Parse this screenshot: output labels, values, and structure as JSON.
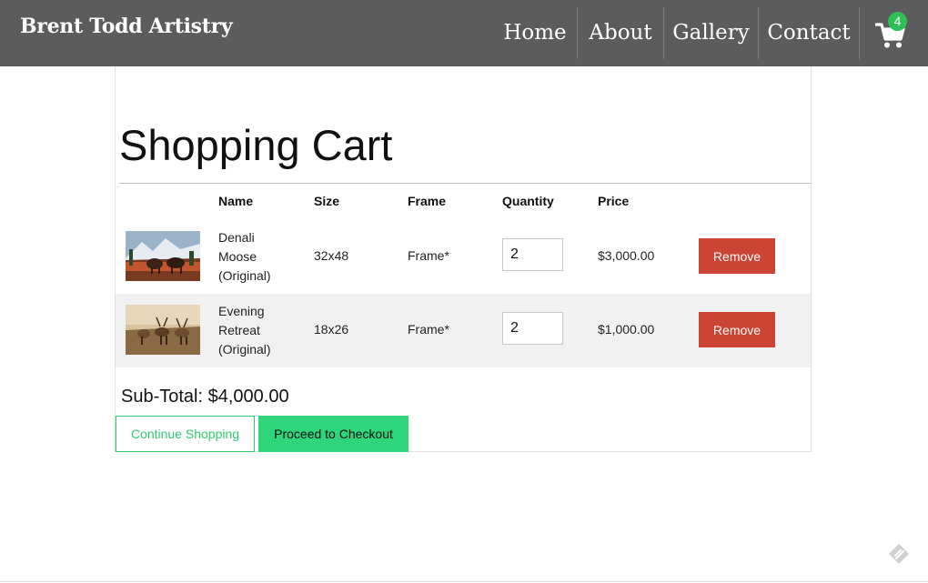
{
  "header": {
    "brand": "Brent Todd Artistry",
    "nav": [
      {
        "label": "Home"
      },
      {
        "label": "About"
      },
      {
        "label": "Gallery"
      },
      {
        "label": "Contact"
      }
    ],
    "cart_count": "4"
  },
  "cart": {
    "title": "Shopping Cart",
    "columns": [
      "Name",
      "Size",
      "Frame",
      "Quantity",
      "Price"
    ],
    "items": [
      {
        "name": "Denali Moose (Original)",
        "size": "32x48",
        "frame": "Frame*",
        "quantity": "2",
        "price": "$3,000.00",
        "remove_label": "Remove",
        "image": "moose-painting"
      },
      {
        "name": "Evening Retreat (Original)",
        "size": "18x26",
        "frame": "Frame*",
        "quantity": "2",
        "price": "$1,000.00",
        "remove_label": "Remove",
        "image": "elk-painting"
      }
    ],
    "subtotal_label": "Sub-Total: $4,000.00",
    "continue_label": "Continue Shopping",
    "checkout_label": "Proceed to Checkout"
  },
  "icons": {
    "cart": "shopping-cart-icon",
    "corner": "feedback-icon"
  },
  "colors": {
    "navbar": "#5c5c5c",
    "badge": "#2fbf57",
    "remove": "#cc4433",
    "checkout": "#2ed57a",
    "continue": "#2ecc71"
  }
}
